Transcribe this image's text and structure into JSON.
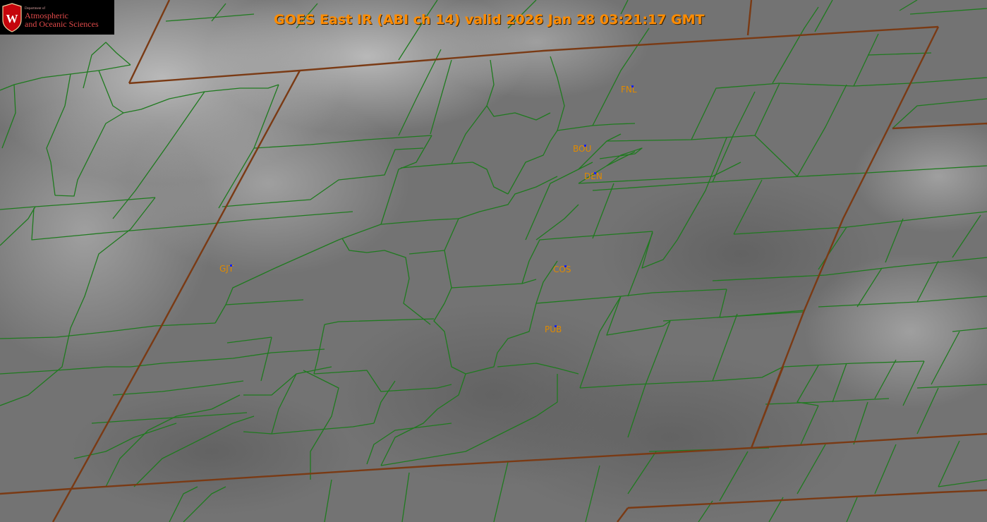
{
  "title": "GOES East IR (ABI ch 14) valid 2026 Jan 28 03:21:17 GMT",
  "logo": {
    "dept": "Department of",
    "line1": "Atmospheric",
    "line2": "and Oceanic Sciences",
    "crest_letter": "W"
  },
  "stations": [
    {
      "id": "FNL",
      "label": "FNL"
    },
    {
      "id": "BOU",
      "label": "BOU"
    },
    {
      "id": "DEN",
      "label": "DEN"
    },
    {
      "id": "GJT",
      "label": "GJT"
    },
    {
      "id": "COS",
      "label": "COS"
    },
    {
      "id": "PUB",
      "label": "PUB"
    }
  ],
  "colors": {
    "state_border": "#7a3a14",
    "county_border": "#1f7a1f",
    "station_label": "#e08a00",
    "station_marker": "#1020ff",
    "title": "#ff8c00"
  }
}
